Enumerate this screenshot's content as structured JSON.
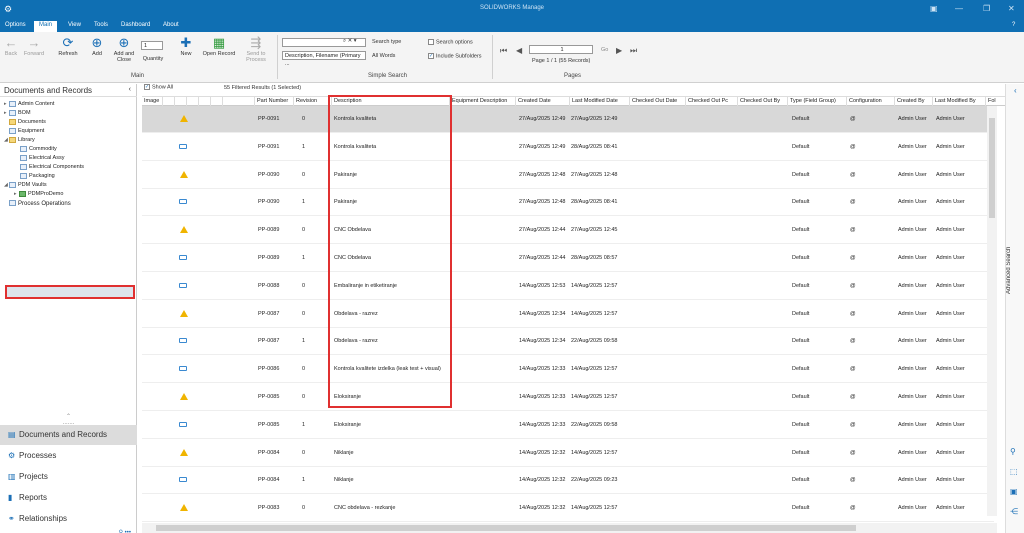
{
  "window": {
    "title": "SOLIDWORKS Manage"
  },
  "menu": [
    "Options",
    "Main",
    "View",
    "Tools",
    "Dashboard",
    "About"
  ],
  "ribbon": {
    "back": "Back",
    "forward": "Forward",
    "refresh": "Refresh",
    "add": "Add",
    "add_close": "Add and Close",
    "quantity": "Quantity",
    "quantity_value": "1",
    "new": "New",
    "open_record": "Open Record",
    "send_to_process": "Send to Process",
    "group_main": "Main",
    "search_field_value": "",
    "search_fields": "Description, Filename (Primary ...",
    "search_type_label": "Search type",
    "search_type_value": "All Words",
    "search_options": "Search options",
    "include_subfolders": "Include Subfolders",
    "group_simple_search": "Simple Search",
    "page_value": "1",
    "go": "Go",
    "page_info": "Page 1 / 1 (55 Records)",
    "group_pages": "Pages"
  },
  "left_panel": {
    "title": "Documents and Records",
    "tree": [
      {
        "label": "Admin Content",
        "icon": "grid"
      },
      {
        "label": "BOM",
        "icon": "grid"
      },
      {
        "label": "Documents",
        "icon": "folder"
      },
      {
        "label": "Equipment",
        "icon": "gear"
      },
      {
        "label": "Library",
        "icon": "folder"
      },
      {
        "label": "Commodity",
        "icon": "grid"
      },
      {
        "label": "Electrical Assy",
        "icon": "grid"
      },
      {
        "label": "Electrical Components",
        "icon": "grid"
      },
      {
        "label": "Packaging",
        "icon": "grid"
      },
      {
        "label": "PDM Vaults",
        "icon": "grid"
      },
      {
        "label": "PDMProDemo",
        "icon": "vault"
      },
      {
        "label": "Process Operations",
        "icon": "process"
      }
    ],
    "nav": [
      "Documents and Records",
      "Processes",
      "Projects",
      "Reports",
      "Relationships"
    ]
  },
  "grid": {
    "show_all": "Show All",
    "filtered_results": "55 Filtered Results  (1 Selected)",
    "columns": [
      "Image",
      "Part Number",
      "Revision",
      "Description",
      "Equipment Description",
      "Created Date",
      "Last Modified Date",
      "Checked Out Date",
      "Checked Out Pc",
      "Checked Out By",
      "Type (Field Group)",
      "Configuration",
      "Created By",
      "Last Modified By",
      "Fol"
    ],
    "rows": [
      {
        "pn": "PP-0091",
        "rev": "0",
        "desc": "Kontrola kvaliteta",
        "created": "27/Aug/2025 12:49",
        "modified": "27/Aug/2025 12:49",
        "type": "Default",
        "config": "@",
        "cby": "Admin User",
        "mby": "Admin User",
        "icon": "warn"
      },
      {
        "pn": "PP-0091",
        "rev": "1",
        "desc": "Kontrola kvaliteta",
        "created": "27/Aug/2025 12:49",
        "modified": "28/Aug/2025 08:41",
        "type": "Default",
        "config": "@",
        "cby": "Admin User",
        "mby": "Admin User",
        "icon": "doc"
      },
      {
        "pn": "PP-0090",
        "rev": "0",
        "desc": "Pakiranje",
        "created": "27/Aug/2025 12:48",
        "modified": "27/Aug/2025 12:48",
        "type": "Default",
        "config": "@",
        "cby": "Admin User",
        "mby": "Admin User",
        "icon": "warn"
      },
      {
        "pn": "PP-0090",
        "rev": "1",
        "desc": "Pakiranje",
        "created": "27/Aug/2025 12:48",
        "modified": "28/Aug/2025 08:41",
        "type": "Default",
        "config": "@",
        "cby": "Admin User",
        "mby": "Admin User",
        "icon": "doc"
      },
      {
        "pn": "PP-0089",
        "rev": "0",
        "desc": "CNC Obdelava",
        "created": "27/Aug/2025 12:44",
        "modified": "27/Aug/2025 12:45",
        "type": "Default",
        "config": "@",
        "cby": "Admin User",
        "mby": "Admin User",
        "icon": "warn"
      },
      {
        "pn": "PP-0089",
        "rev": "1",
        "desc": "CNC Obdelava",
        "created": "27/Aug/2025 12:44",
        "modified": "28/Aug/2025 08:57",
        "type": "Default",
        "config": "@",
        "cby": "Admin User",
        "mby": "Admin User",
        "icon": "doc"
      },
      {
        "pn": "PP-0088",
        "rev": "0",
        "desc": "Embaliranje in etiketiranje",
        "created": "14/Aug/2025 12:53",
        "modified": "14/Aug/2025 12:57",
        "type": "Default",
        "config": "@",
        "cby": "Admin User",
        "mby": "Admin User",
        "icon": "doc"
      },
      {
        "pn": "PP-0087",
        "rev": "0",
        "desc": "Obdelava - razrez",
        "created": "14/Aug/2025 12:34",
        "modified": "14/Aug/2025 12:57",
        "type": "Default",
        "config": "@",
        "cby": "Admin User",
        "mby": "Admin User",
        "icon": "warn"
      },
      {
        "pn": "PP-0087",
        "rev": "1",
        "desc": "Obdelava - razrez",
        "created": "14/Aug/2025 12:34",
        "modified": "22/Aug/2025 09:58",
        "type": "Default",
        "config": "@",
        "cby": "Admin User",
        "mby": "Admin User",
        "icon": "doc"
      },
      {
        "pn": "PP-0086",
        "rev": "0",
        "desc": "Kontrola kvalitete izdelka (leak test + visual)",
        "created": "14/Aug/2025 12:33",
        "modified": "14/Aug/2025 12:57",
        "type": "Default",
        "config": "@",
        "cby": "Admin User",
        "mby": "Admin User",
        "icon": "doc"
      },
      {
        "pn": "PP-0085",
        "rev": "0",
        "desc": "Eloksiranje",
        "created": "14/Aug/2025 12:33",
        "modified": "14/Aug/2025 12:57",
        "type": "Default",
        "config": "@",
        "cby": "Admin User",
        "mby": "Admin User",
        "icon": "warn"
      },
      {
        "pn": "PP-0085",
        "rev": "1",
        "desc": "Eloksiranje",
        "created": "14/Aug/2025 12:33",
        "modified": "22/Aug/2025 09:58",
        "type": "Default",
        "config": "@",
        "cby": "Admin User",
        "mby": "Admin User",
        "icon": "doc"
      },
      {
        "pn": "PP-0084",
        "rev": "0",
        "desc": "Niklanje",
        "created": "14/Aug/2025 12:32",
        "modified": "14/Aug/2025 12:57",
        "type": "Default",
        "config": "@",
        "cby": "Admin User",
        "mby": "Admin User",
        "icon": "warn"
      },
      {
        "pn": "PP-0084",
        "rev": "1",
        "desc": "Niklanje",
        "created": "14/Aug/2025 12:32",
        "modified": "22/Aug/2025 09:23",
        "type": "Default",
        "config": "@",
        "cby": "Admin User",
        "mby": "Admin User",
        "icon": "doc"
      },
      {
        "pn": "PP-0083",
        "rev": "0",
        "desc": "CNC obdelava - rezkanje",
        "created": "14/Aug/2025 12:32",
        "modified": "14/Aug/2025 12:57",
        "type": "Default",
        "config": "@",
        "cby": "Admin User",
        "mby": "Admin User",
        "icon": "warn"
      }
    ]
  },
  "side": {
    "advanced_search": "Advanced Search"
  }
}
